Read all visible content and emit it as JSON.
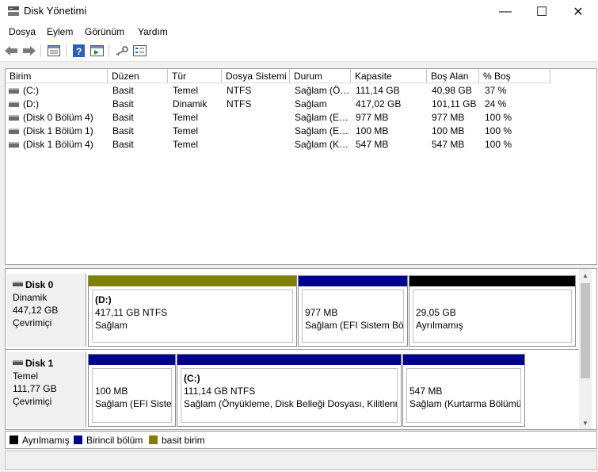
{
  "window": {
    "title": "Disk Yönetimi",
    "minimize_glyph": "—",
    "maximize_glyph": "☐",
    "close_glyph": "✕"
  },
  "menu": [
    "Dosya",
    "Eylem",
    "Görünüm",
    "Yardım"
  ],
  "toolbar": {
    "icons": [
      "back-arrow-icon",
      "forward-arrow-icon",
      "disk-list-icon",
      "help-icon",
      "console-icon",
      "key-icon",
      "properties-icon"
    ]
  },
  "volume_table": {
    "columns": [
      "Birim",
      "Düzen",
      "Tür",
      "Dosya Sistemi",
      "Durum",
      "Kapasite",
      "Boş Alan",
      "% Boş"
    ],
    "rows": [
      [
        "(C:)",
        "Basit",
        "Temel",
        "NTFS",
        "Sağlam (Ö…",
        "111,14 GB",
        "40,98 GB",
        "37 %"
      ],
      [
        "(D:)",
        "Basit",
        "Dinamik",
        "NTFS",
        "Sağlam",
        "417,02 GB",
        "101,11 GB",
        "24 %"
      ],
      [
        "(Disk 0 Bölüm 4)",
        "Basit",
        "Temel",
        "",
        "Sağlam (E…",
        "977 MB",
        "977 MB",
        "100 %"
      ],
      [
        "(Disk 1 Bölüm 1)",
        "Basit",
        "Temel",
        "",
        "Sağlam (E…",
        "100 MB",
        "100 MB",
        "100 %"
      ],
      [
        "(Disk 1 Bölüm 4)",
        "Basit",
        "Temel",
        "",
        "Sağlam (K…",
        "547 MB",
        "547 MB",
        "100 %"
      ]
    ]
  },
  "disks": [
    {
      "name": "Disk 0",
      "type": "Dinamik",
      "size": "447,12 GB",
      "state": "Çevrimiçi",
      "partitions": [
        {
          "label": "(D:)",
          "size": "417,11 GB NTFS",
          "status": "Sağlam",
          "bar_color": "#808000"
        },
        {
          "label": "",
          "size": "977 MB",
          "status": "Sağlam (EFI Sistem Bölü",
          "bar_color": "#00008b"
        },
        {
          "label": "",
          "size": "29,05 GB",
          "status": "Ayrılmamış",
          "bar_color": "#000000"
        }
      ]
    },
    {
      "name": "Disk 1",
      "type": "Temel",
      "size": "111,77 GB",
      "state": "Çevrimiçi",
      "partitions": [
        {
          "label": "",
          "size": "100 MB",
          "status": "Sağlam (EFI Sistem",
          "bar_color": "#00008b"
        },
        {
          "label": "(C:)",
          "size": "111,14 GB NTFS",
          "status": "Sağlam (Önyükleme, Disk Belleği Dosyası, Kilitlenm",
          "bar_color": "#00008b"
        },
        {
          "label": "",
          "size": "547 MB",
          "status": "Sağlam (Kurtarma Bölümü",
          "bar_color": "#00008b"
        }
      ]
    }
  ],
  "legend": [
    {
      "label": "Ayrılmamış",
      "color": "#000000"
    },
    {
      "label": "Birincil bölüm",
      "color": "#00008b"
    },
    {
      "label": "basit birim",
      "color": "#808000"
    }
  ]
}
